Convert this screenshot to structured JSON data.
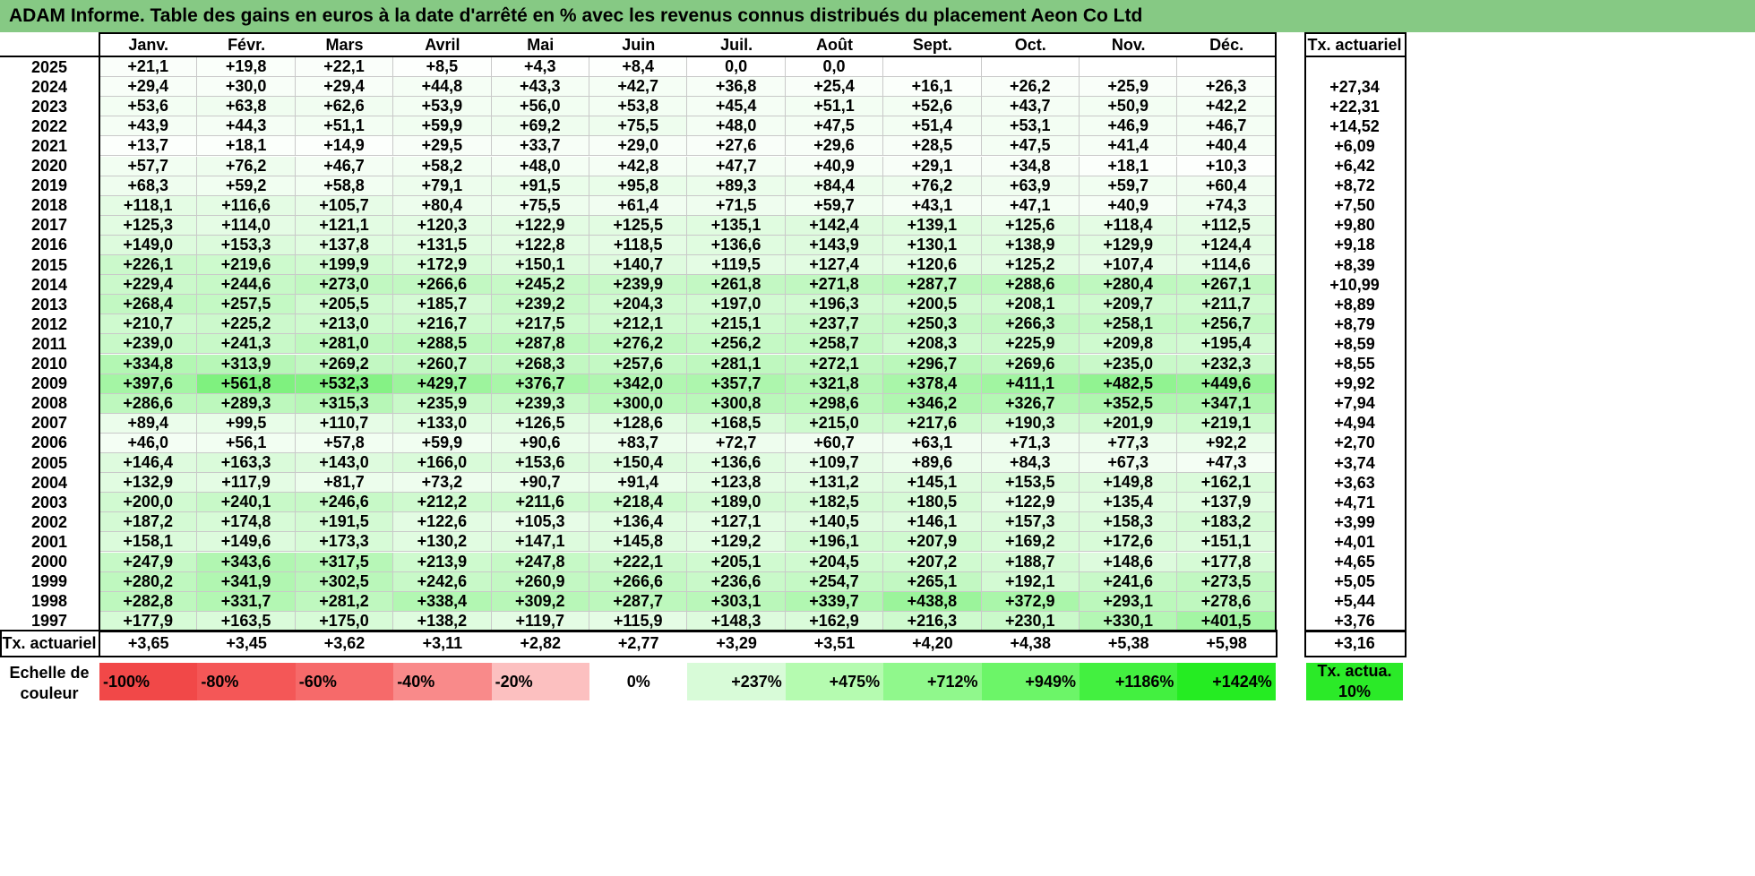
{
  "title": "ADAM Informe. Table des gains en euros à la date d'arrêté en % avec les revenus connus distribués du placement Aeon Co Ltd",
  "chart_data": {
    "type": "table",
    "months": [
      "Janv.",
      "Févr.",
      "Mars",
      "Avril",
      "Mai",
      "Juin",
      "Juil.",
      "Août",
      "Sept.",
      "Oct.",
      "Nov.",
      "Déc."
    ],
    "rate_header": "Tx. actuariel",
    "rows": [
      {
        "year": "2025",
        "values": [
          "+21,1",
          "+19,8",
          "+22,1",
          "+8,5",
          "+4,3",
          "+8,4",
          "0,0",
          "0,0",
          "",
          "",
          "",
          ""
        ],
        "rate": ""
      },
      {
        "year": "2024",
        "values": [
          "+29,4",
          "+30,0",
          "+29,4",
          "+44,8",
          "+43,3",
          "+42,7",
          "+36,8",
          "+25,4",
          "+16,1",
          "+26,2",
          "+25,9",
          "+26,3"
        ],
        "rate": "+27,34"
      },
      {
        "year": "2023",
        "values": [
          "+53,6",
          "+63,8",
          "+62,6",
          "+53,9",
          "+56,0",
          "+53,8",
          "+45,4",
          "+51,1",
          "+52,6",
          "+43,7",
          "+50,9",
          "+42,2"
        ],
        "rate": "+22,31"
      },
      {
        "year": "2022",
        "values": [
          "+43,9",
          "+44,3",
          "+51,1",
          "+59,9",
          "+69,2",
          "+75,5",
          "+48,0",
          "+47,5",
          "+51,4",
          "+53,1",
          "+46,9",
          "+46,7"
        ],
        "rate": "+14,52"
      },
      {
        "year": "2021",
        "values": [
          "+13,7",
          "+18,1",
          "+14,9",
          "+29,5",
          "+33,7",
          "+29,0",
          "+27,6",
          "+29,6",
          "+28,5",
          "+47,5",
          "+41,4",
          "+40,4"
        ],
        "rate": "+6,09"
      },
      {
        "year": "2020",
        "values": [
          "+57,7",
          "+76,2",
          "+46,7",
          "+58,2",
          "+48,0",
          "+42,8",
          "+47,7",
          "+40,9",
          "+29,1",
          "+34,8",
          "+18,1",
          "+10,3"
        ],
        "rate": "+6,42"
      },
      {
        "year": "2019",
        "values": [
          "+68,3",
          "+59,2",
          "+58,8",
          "+79,1",
          "+91,5",
          "+95,8",
          "+89,3",
          "+84,4",
          "+76,2",
          "+63,9",
          "+59,7",
          "+60,4"
        ],
        "rate": "+8,72"
      },
      {
        "year": "2018",
        "values": [
          "+118,1",
          "+116,6",
          "+105,7",
          "+80,4",
          "+75,5",
          "+61,4",
          "+71,5",
          "+59,7",
          "+43,1",
          "+47,1",
          "+40,9",
          "+74,3"
        ],
        "rate": "+7,50"
      },
      {
        "year": "2017",
        "values": [
          "+125,3",
          "+114,0",
          "+121,1",
          "+120,3",
          "+122,9",
          "+125,5",
          "+135,1",
          "+142,4",
          "+139,1",
          "+125,6",
          "+118,4",
          "+112,5"
        ],
        "rate": "+9,80"
      },
      {
        "year": "2016",
        "values": [
          "+149,0",
          "+153,3",
          "+137,8",
          "+131,5",
          "+122,8",
          "+118,5",
          "+136,6",
          "+143,9",
          "+130,1",
          "+138,9",
          "+129,9",
          "+124,4"
        ],
        "rate": "+9,18"
      },
      {
        "year": "2015",
        "values": [
          "+226,1",
          "+219,6",
          "+199,9",
          "+172,9",
          "+150,1",
          "+140,7",
          "+119,5",
          "+127,4",
          "+120,6",
          "+125,2",
          "+107,4",
          "+114,6"
        ],
        "rate": "+8,39"
      },
      {
        "year": "2014",
        "values": [
          "+229,4",
          "+244,6",
          "+273,0",
          "+266,6",
          "+245,2",
          "+239,9",
          "+261,8",
          "+271,8",
          "+287,7",
          "+288,6",
          "+280,4",
          "+267,1"
        ],
        "rate": "+10,99"
      },
      {
        "year": "2013",
        "values": [
          "+268,4",
          "+257,5",
          "+205,5",
          "+185,7",
          "+239,2",
          "+204,3",
          "+197,0",
          "+196,3",
          "+200,5",
          "+208,1",
          "+209,7",
          "+211,7"
        ],
        "rate": "+8,89"
      },
      {
        "year": "2012",
        "values": [
          "+210,7",
          "+225,2",
          "+213,0",
          "+216,7",
          "+217,5",
          "+212,1",
          "+215,1",
          "+237,7",
          "+250,3",
          "+266,3",
          "+258,1",
          "+256,7"
        ],
        "rate": "+8,79"
      },
      {
        "year": "2011",
        "values": [
          "+239,0",
          "+241,3",
          "+281,0",
          "+288,5",
          "+287,8",
          "+276,2",
          "+256,2",
          "+258,7",
          "+208,3",
          "+225,9",
          "+209,8",
          "+195,4"
        ],
        "rate": "+8,59"
      },
      {
        "year": "2010",
        "values": [
          "+334,8",
          "+313,9",
          "+269,2",
          "+260,7",
          "+268,3",
          "+257,6",
          "+281,1",
          "+272,1",
          "+296,7",
          "+269,6",
          "+235,0",
          "+232,3"
        ],
        "rate": "+8,55"
      },
      {
        "year": "2009",
        "values": [
          "+397,6",
          "+561,8",
          "+532,3",
          "+429,7",
          "+376,7",
          "+342,0",
          "+357,7",
          "+321,8",
          "+378,4",
          "+411,1",
          "+482,5",
          "+449,6"
        ],
        "rate": "+9,92"
      },
      {
        "year": "2008",
        "values": [
          "+286,6",
          "+289,3",
          "+315,3",
          "+235,9",
          "+239,3",
          "+300,0",
          "+300,8",
          "+298,6",
          "+346,2",
          "+326,7",
          "+352,5",
          "+347,1"
        ],
        "rate": "+7,94"
      },
      {
        "year": "2007",
        "values": [
          "+89,4",
          "+99,5",
          "+110,7",
          "+133,0",
          "+126,5",
          "+128,6",
          "+168,5",
          "+215,0",
          "+217,6",
          "+190,3",
          "+201,9",
          "+219,1"
        ],
        "rate": "+4,94"
      },
      {
        "year": "2006",
        "values": [
          "+46,0",
          "+56,1",
          "+57,8",
          "+59,9",
          "+90,6",
          "+83,7",
          "+72,7",
          "+60,7",
          "+63,1",
          "+71,3",
          "+77,3",
          "+92,2"
        ],
        "rate": "+2,70"
      },
      {
        "year": "2005",
        "values": [
          "+146,4",
          "+163,3",
          "+143,0",
          "+166,0",
          "+153,6",
          "+150,4",
          "+136,6",
          "+109,7",
          "+89,6",
          "+84,3",
          "+67,3",
          "+47,3"
        ],
        "rate": "+3,74"
      },
      {
        "year": "2004",
        "values": [
          "+132,9",
          "+117,9",
          "+81,7",
          "+73,2",
          "+90,7",
          "+91,4",
          "+123,8",
          "+131,2",
          "+145,1",
          "+153,5",
          "+149,8",
          "+162,1"
        ],
        "rate": "+3,63"
      },
      {
        "year": "2003",
        "values": [
          "+200,0",
          "+240,1",
          "+246,6",
          "+212,2",
          "+211,6",
          "+218,4",
          "+189,0",
          "+182,5",
          "+180,5",
          "+122,9",
          "+135,4",
          "+137,9"
        ],
        "rate": "+4,71"
      },
      {
        "year": "2002",
        "values": [
          "+187,2",
          "+174,8",
          "+191,5",
          "+122,6",
          "+105,3",
          "+136,4",
          "+127,1",
          "+140,5",
          "+146,1",
          "+157,3",
          "+158,3",
          "+183,2"
        ],
        "rate": "+3,99"
      },
      {
        "year": "2001",
        "values": [
          "+158,1",
          "+149,6",
          "+173,3",
          "+130,2",
          "+147,1",
          "+145,8",
          "+129,2",
          "+196,1",
          "+207,9",
          "+169,2",
          "+172,6",
          "+151,1"
        ],
        "rate": "+4,01"
      },
      {
        "year": "2000",
        "values": [
          "+247,9",
          "+343,6",
          "+317,5",
          "+213,9",
          "+247,8",
          "+222,1",
          "+205,1",
          "+204,5",
          "+207,2",
          "+188,7",
          "+148,6",
          "+177,8"
        ],
        "rate": "+4,65"
      },
      {
        "year": "1999",
        "values": [
          "+280,2",
          "+341,9",
          "+302,5",
          "+242,6",
          "+260,9",
          "+266,6",
          "+236,6",
          "+254,7",
          "+265,1",
          "+192,1",
          "+241,6",
          "+273,5"
        ],
        "rate": "+5,05"
      },
      {
        "year": "1998",
        "values": [
          "+282,8",
          "+331,7",
          "+281,2",
          "+338,4",
          "+309,2",
          "+287,7",
          "+303,1",
          "+339,7",
          "+438,8",
          "+372,9",
          "+293,1",
          "+278,6"
        ],
        "rate": "+5,44"
      },
      {
        "year": "1997",
        "values": [
          "+177,9",
          "+163,5",
          "+175,0",
          "+138,2",
          "+119,7",
          "+115,9",
          "+148,3",
          "+162,9",
          "+216,3",
          "+230,1",
          "+330,1",
          "+401,5"
        ],
        "rate": "+3,76"
      }
    ],
    "footer": {
      "label": "Tx. actuariel",
      "values": [
        "+3,65",
        "+3,45",
        "+3,62",
        "+3,11",
        "+2,82",
        "+2,77",
        "+3,29",
        "+3,51",
        "+4,20",
        "+4,38",
        "+5,38",
        "+5,98"
      ],
      "rate": "+3,16"
    },
    "legend": {
      "label": "Echelle de couleur",
      "items": [
        {
          "text": "-100%",
          "color": "#f14848"
        },
        {
          "text": "-80%",
          "color": "#f45757"
        },
        {
          "text": "-60%",
          "color": "#f66a6a"
        },
        {
          "text": "-40%",
          "color": "#f98a8a"
        },
        {
          "text": "-20%",
          "color": "#fcc0c0"
        },
        {
          "text": "0%",
          "color": "#ffffff"
        },
        {
          "text": "+237%",
          "color": "#d8fbd8"
        },
        {
          "text": "+475%",
          "color": "#b5fbb0"
        },
        {
          "text": "+712%",
          "color": "#90f88c"
        },
        {
          "text": "+949%",
          "color": "#6cf568"
        },
        {
          "text": "+1186%",
          "color": "#43f040"
        },
        {
          "text": "+1424%",
          "color": "#25ec22"
        }
      ],
      "actua_label": "Tx. actua. 10%",
      "actua_color": "#2bea28"
    },
    "color_scale_max": 1424
  }
}
